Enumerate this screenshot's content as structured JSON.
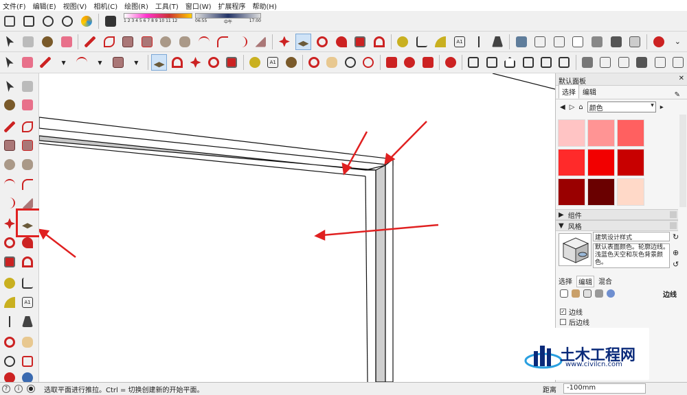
{
  "menu": [
    "文件(F)",
    "编辑(E)",
    "视图(V)",
    "相机(C)",
    "绘图(R)",
    "工具(T)",
    "窗口(W)",
    "扩展程序",
    "帮助(H)"
  ],
  "shadow_strip": {
    "numbers": "1 2 3 4 5 6 7 8 9 10 11 12",
    "time_start": "06:55",
    "time_mid": "中午",
    "time_end": "17:00"
  },
  "tray": {
    "title": "默认面板",
    "materials": {
      "tabs": [
        "选择",
        "编辑"
      ],
      "selected_library": "颜色",
      "swatch_colors": [
        "#ffc4c4",
        "#ff9494",
        "#ff6060",
        "#ff2a2a",
        "#f20000",
        "#c80000",
        "#9a0000",
        "#6a0000",
        "#ffd9c8"
      ]
    },
    "components_label": "组件",
    "styles": {
      "header": "风格",
      "style_name": "建筑设计样式",
      "description": "默认表面颜色。轮廓边线。浅蓝色天空和灰色背景颜色。",
      "tabs": [
        "选择",
        "编辑",
        "混合"
      ],
      "edge_section": "边线",
      "edges_checkbox": "边线",
      "edges_checked": true,
      "back_edges_checkbox": "后边线",
      "back_edges_checked": false
    }
  },
  "status": {
    "message": "选取平面进行推拉。Ctrl = 切换创建新的开始平面。",
    "measure_label": "距离",
    "measure_value": "-100mm"
  },
  "watermark": {
    "brand": "土木工程网",
    "url": "www.civilcn.com"
  },
  "colors": {
    "accent": "#e02020",
    "highlight": "#cfe3f7",
    "brand": "#0a2a7a"
  }
}
